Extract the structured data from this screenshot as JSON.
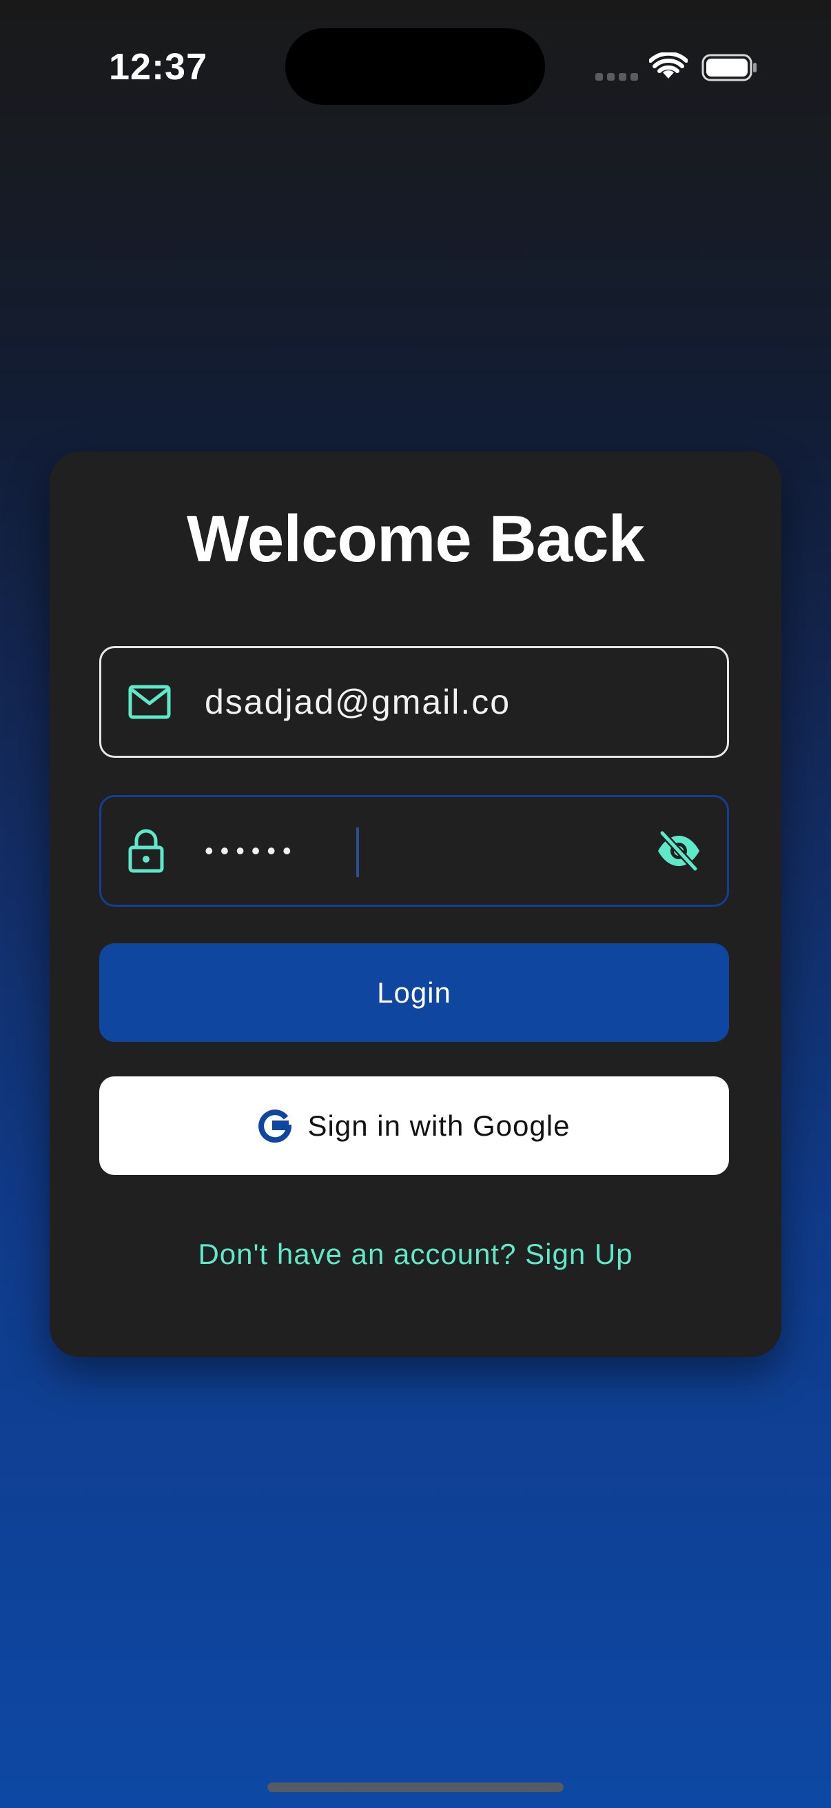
{
  "status_bar": {
    "time": "12:37",
    "wifi_icon": "wifi-icon",
    "battery_icon": "battery-full-icon"
  },
  "card": {
    "title": "Welcome Back",
    "email_field": {
      "value": "dsadjad@gmail.co",
      "icon": "mail-icon"
    },
    "password_field": {
      "masked_value": "••••••",
      "icon": "lock-icon",
      "toggle_icon": "eye-off-icon"
    },
    "login_button": {
      "label": "Login"
    },
    "google_button": {
      "label": "Sign in with Google",
      "icon": "google-icon"
    },
    "signup_link": "Don't have an account? Sign Up"
  },
  "colors": {
    "accent": "#5ee9c9",
    "primary": "#0f47a0",
    "card_bg": "#202021"
  }
}
